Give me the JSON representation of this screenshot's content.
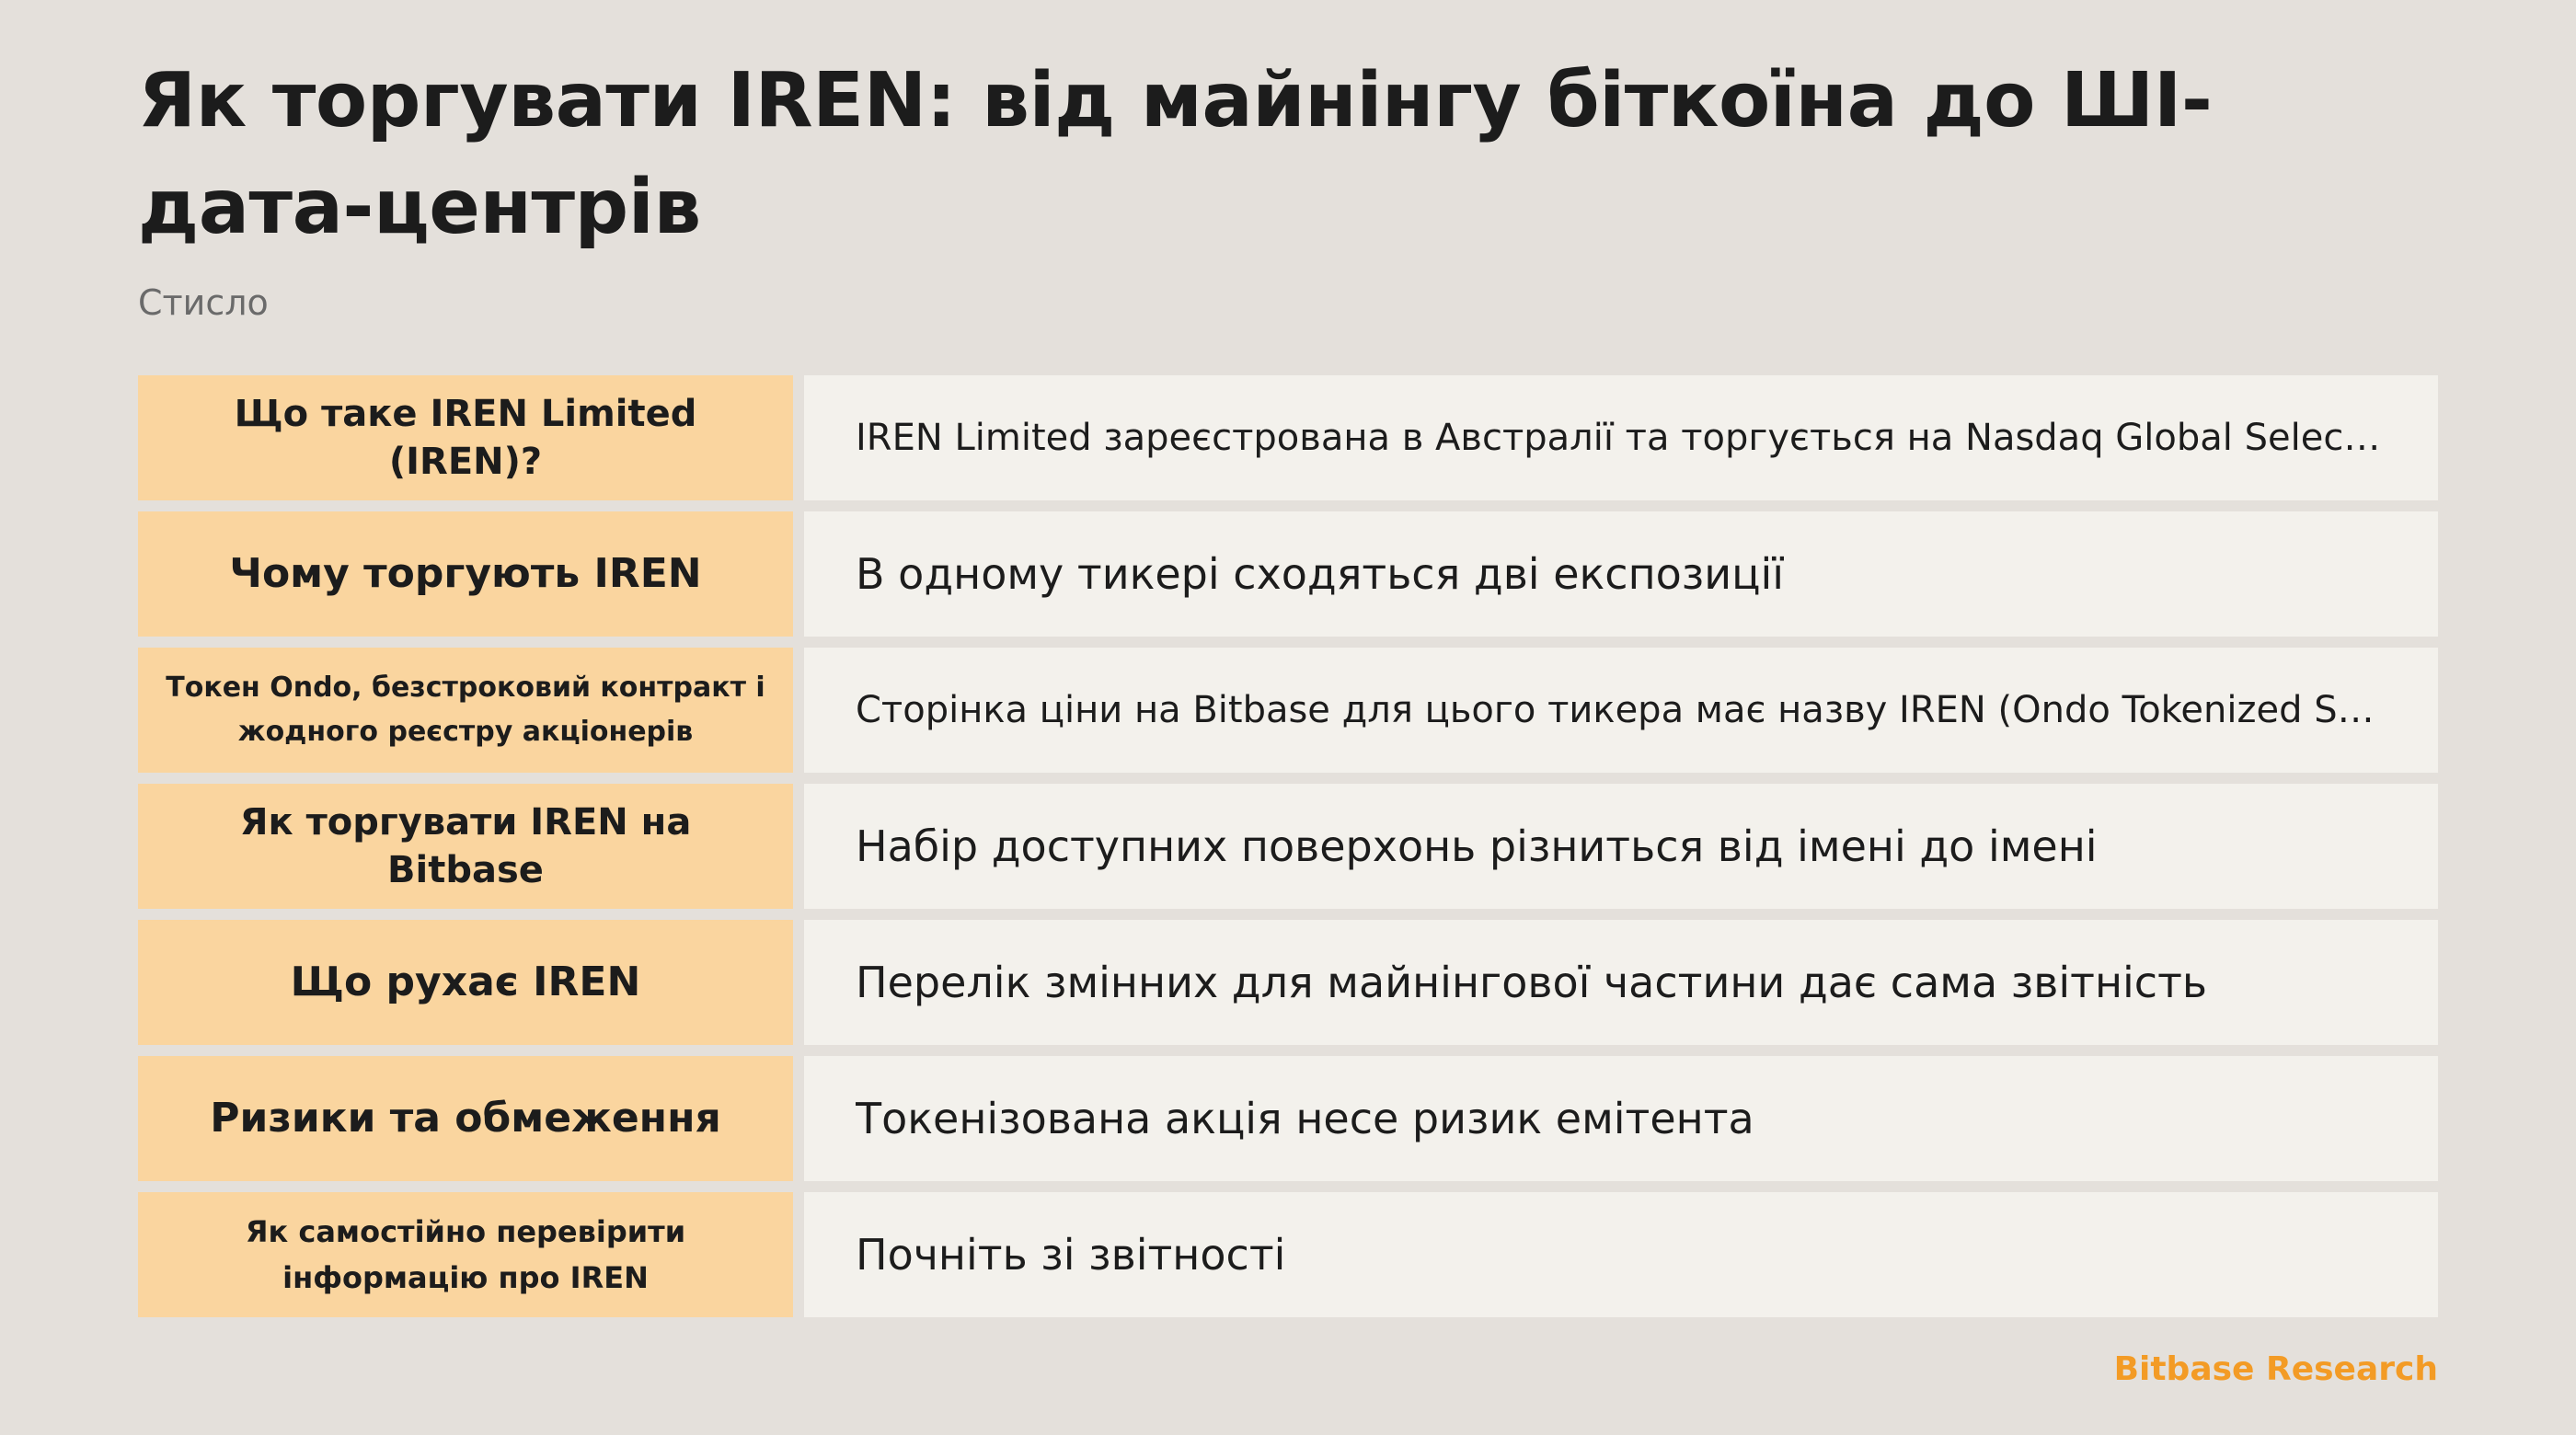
{
  "header": {
    "title": "Як торгувати IREN: від майнінгу біткоїна до ШІ-дата-центрів",
    "subtitle": "Стисло"
  },
  "rows": [
    {
      "label": "Що таке IREN Limited (IREN)?",
      "value": "IREN Limited зареєстрована в Австралії та торгується на Nasdaq Global Select Market"
    },
    {
      "label": "Чому торгують IREN",
      "value": "В одному тикері сходяться дві експозиції"
    },
    {
      "label": "Токен Ondo, безстроковий контракт і жодного реєстру акціонерів",
      "value": "Сторінка ціни на Bitbase для цього тикера має назву IREN (Ondo Tokenized Stock)"
    },
    {
      "label": "Як торгувати IREN на Bitbase",
      "value": "Набір доступних поверхонь різниться від імені до імені"
    },
    {
      "label": "Що рухає IREN",
      "value": "Перелік змінних для майнінгової частини дає сама звітність"
    },
    {
      "label": "Ризики та обмеження",
      "value": "Токенізована акція несе ризик емітента"
    },
    {
      "label": "Як самостійно перевірити інформацію про IREN",
      "value": "Почніть зі звітності"
    }
  ],
  "footer": {
    "brand": "Bitbase Research"
  },
  "colors": {
    "background": "#e4e0db",
    "label_cell": "#fad59f",
    "value_cell": "#f3f1ec",
    "brand": "#f39b25"
  }
}
